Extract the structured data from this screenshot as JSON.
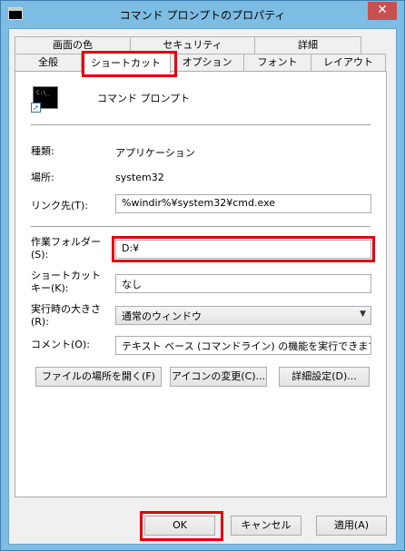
{
  "window": {
    "title": "コマンド プロンプトのプロパティ",
    "close_label": "✕"
  },
  "tabs": {
    "back_row": [
      "画面の色",
      "セキュリティ",
      "詳細"
    ],
    "front_row": [
      "全般",
      "ショートカット",
      "オプション",
      "フォント",
      "レイアウト"
    ],
    "active": "ショートカット"
  },
  "shortcut": {
    "app_name": "コマンド プロンプト",
    "icon_text": "C:\\_",
    "type_label": "種類:",
    "type_value": "アプリケーション",
    "location_label": "場所:",
    "location_value": "system32",
    "target_label": "リンク先(T):",
    "target_value": "%windir%¥system32¥cmd.exe",
    "workdir_label": "作業フォルダー(S):",
    "workdir_value": "D:¥",
    "hotkey_label": "ショートカットキー(K):",
    "hotkey_value": "なし",
    "run_label": "実行時の大きさ(R):",
    "run_value": "通常のウィンドウ",
    "comment_label": "コメント(O):",
    "comment_value": "テキスト ベース (コマンドライン) の機能を実行できます。"
  },
  "buttons": {
    "open_location": "ファイルの場所を開く(F)",
    "change_icon": "アイコンの変更(C)...",
    "advanced": "詳細設定(D)..."
  },
  "footer": {
    "ok": "OK",
    "cancel": "キャンセル",
    "apply": "適用(A)"
  }
}
